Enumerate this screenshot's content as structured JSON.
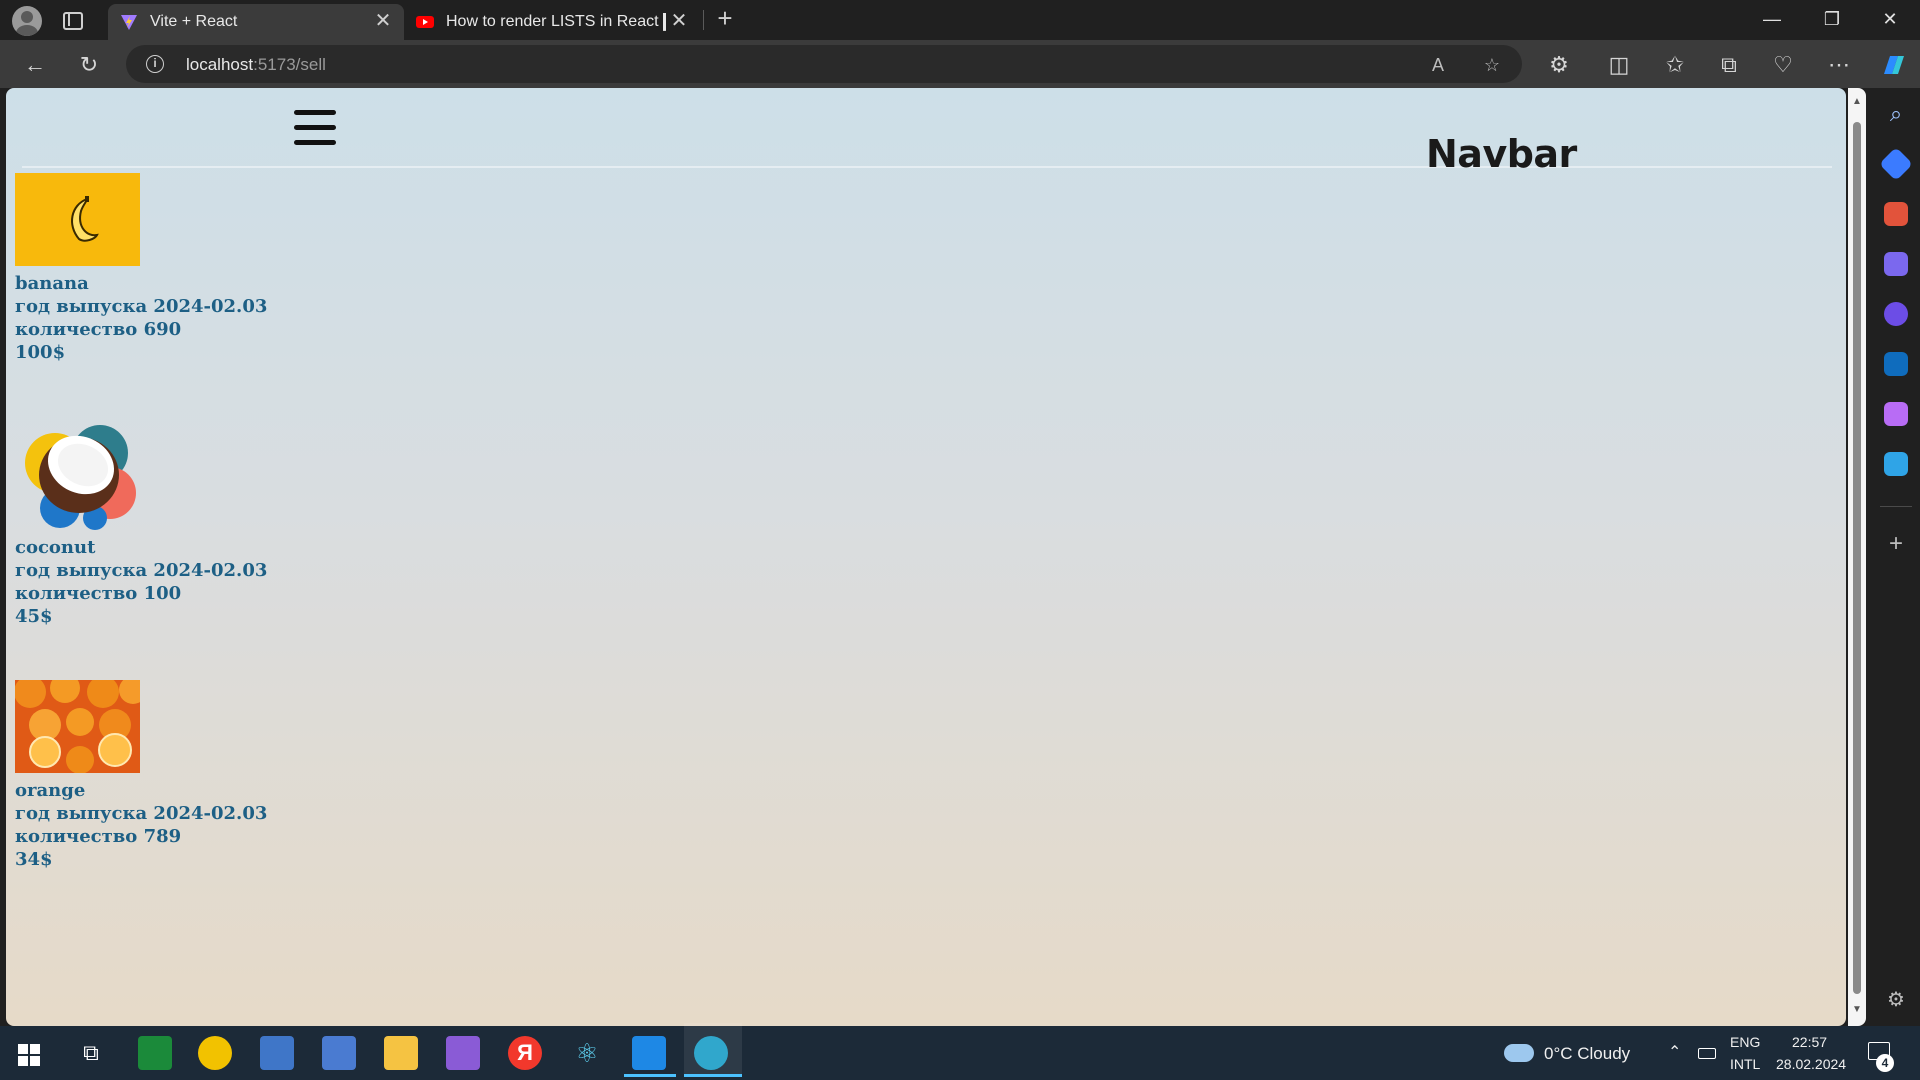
{
  "browser": {
    "tabs": [
      {
        "title": "Vite + React",
        "active": true
      },
      {
        "title": "How to render LISTS in React █",
        "active": false
      }
    ],
    "address": {
      "host": "localhost",
      "path": ":5173/sell"
    }
  },
  "page": {
    "navbar": {
      "brand": "Navbar"
    },
    "products": [
      {
        "name": "banana",
        "year_label": "год выпуска 2024-02.03",
        "qty_label": "количество 690",
        "price": "100$"
      },
      {
        "name": "coconut",
        "year_label": "год выпуска 2024-02.03",
        "qty_label": "количество 100",
        "price": "45$"
      },
      {
        "name": "orange",
        "year_label": "год выпуска 2024-02.03",
        "qty_label": "количество 789",
        "price": "34$"
      }
    ]
  },
  "taskbar": {
    "weather": "0°C  Cloudy",
    "lang_top": "ENG",
    "lang_bottom": "INTL",
    "time": "22:57",
    "date": "28.02.2024",
    "notifications": "4"
  },
  "colors": {
    "product_text": "#1d5f85",
    "page_gradient_top": "#cddfe8",
    "page_gradient_bottom": "#e6dac8"
  }
}
